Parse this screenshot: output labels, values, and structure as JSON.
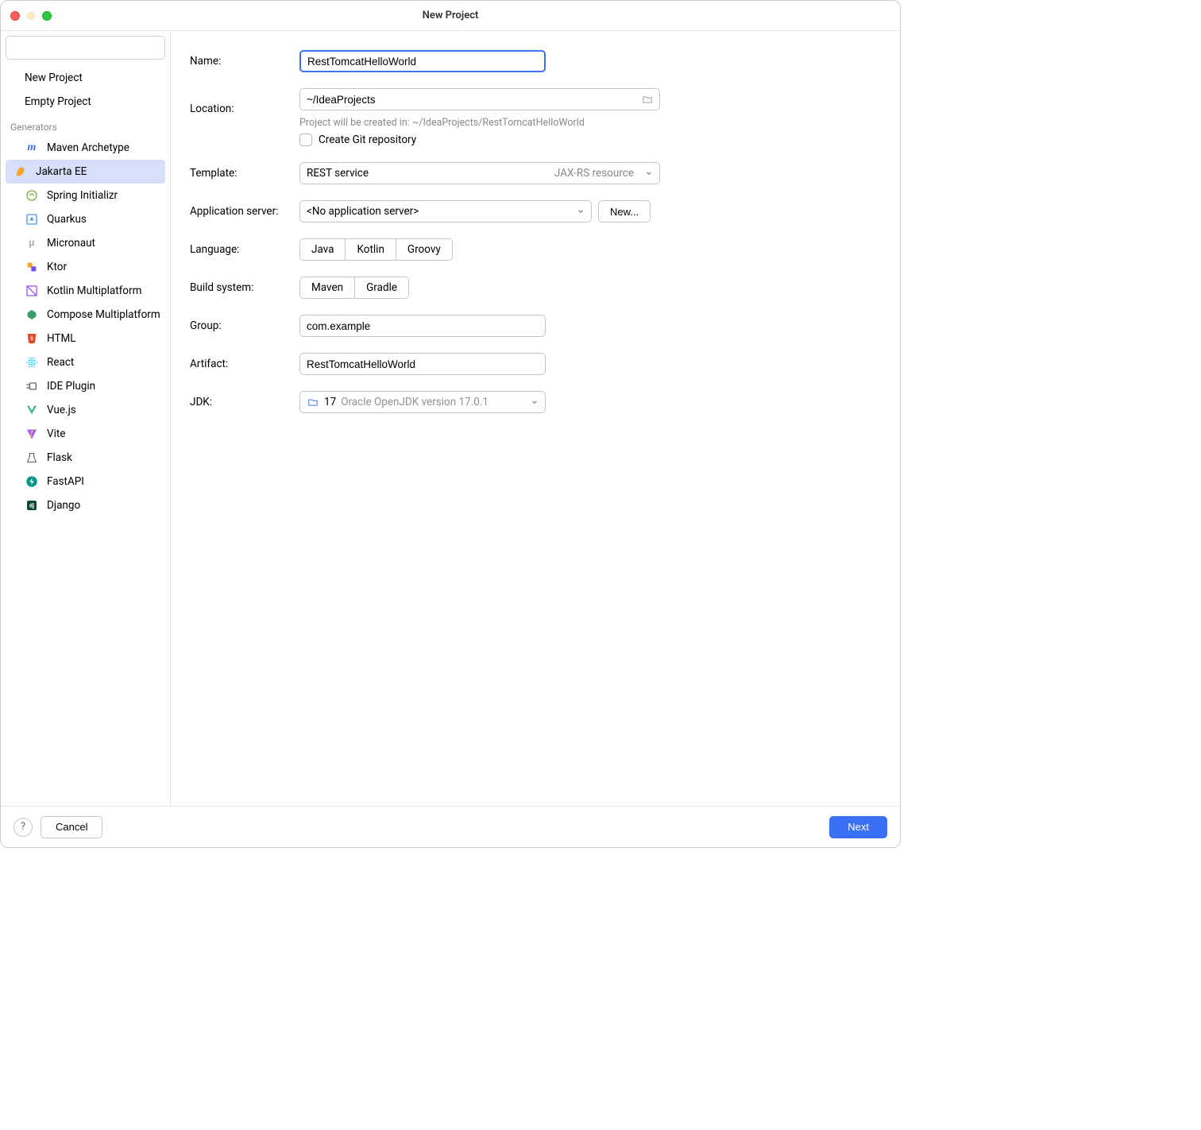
{
  "window": {
    "title": "New Project"
  },
  "sidebar": {
    "search_placeholder": "",
    "top_items": [
      {
        "label": "New Project"
      },
      {
        "label": "Empty Project"
      }
    ],
    "section_label": "Generators",
    "generators": [
      {
        "label": "Maven Archetype",
        "icon": "maven",
        "color": "#3b6ff5"
      },
      {
        "label": "Jakarta EE",
        "icon": "jakarta",
        "color": "#f5a623",
        "selected": true
      },
      {
        "label": "Spring Initializr",
        "icon": "spring",
        "color": "#6db33f"
      },
      {
        "label": "Quarkus",
        "icon": "quarkus",
        "color": "#4695eb"
      },
      {
        "label": "Micronaut",
        "icon": "micronaut",
        "color": "#888"
      },
      {
        "label": "Ktor",
        "icon": "ktor",
        "color": "#f5a623"
      },
      {
        "label": "Kotlin Multiplatform",
        "icon": "kotlin-mp",
        "color": "#9b59ff"
      },
      {
        "label": "Compose Multiplatform",
        "icon": "compose",
        "color": "#3b9b6f"
      },
      {
        "label": "HTML",
        "icon": "html",
        "color": "#e34c26"
      },
      {
        "label": "React",
        "icon": "react",
        "color": "#61dafb"
      },
      {
        "label": "IDE Plugin",
        "icon": "plugin",
        "color": "#666"
      },
      {
        "label": "Vue.js",
        "icon": "vue",
        "color": "#41b883"
      },
      {
        "label": "Vite",
        "icon": "vite",
        "color": "#a259ff"
      },
      {
        "label": "Flask",
        "icon": "flask",
        "color": "#555"
      },
      {
        "label": "FastAPI",
        "icon": "fastapi",
        "color": "#009688"
      },
      {
        "label": "Django",
        "icon": "django",
        "color": "#0c4b33"
      }
    ]
  },
  "form": {
    "name_label": "Name:",
    "name_value": "RestTomcatHelloWorld",
    "location_label": "Location:",
    "location_value": "~/IdeaProjects",
    "location_hint": "Project will be created in: ~/IdeaProjects/RestTomcatHelloWorld",
    "git_label": "Create Git repository",
    "git_checked": false,
    "template_label": "Template:",
    "template_value": "REST service",
    "template_right": "JAX-RS resource",
    "appserver_label": "Application server:",
    "appserver_value": "<No application server>",
    "appserver_new": "New...",
    "language_label": "Language:",
    "language_options": [
      "Java",
      "Kotlin",
      "Groovy"
    ],
    "language_selected": "Java",
    "build_label": "Build system:",
    "build_options": [
      "Maven",
      "Gradle"
    ],
    "build_selected": "Maven",
    "group_label": "Group:",
    "group_value": "com.example",
    "artifact_label": "Artifact:",
    "artifact_value": "RestTomcatHelloWorld",
    "jdk_label": "JDK:",
    "jdk_version": "17",
    "jdk_desc": "Oracle OpenJDK version 17.0.1"
  },
  "footer": {
    "help": "?",
    "cancel": "Cancel",
    "next": "Next"
  }
}
